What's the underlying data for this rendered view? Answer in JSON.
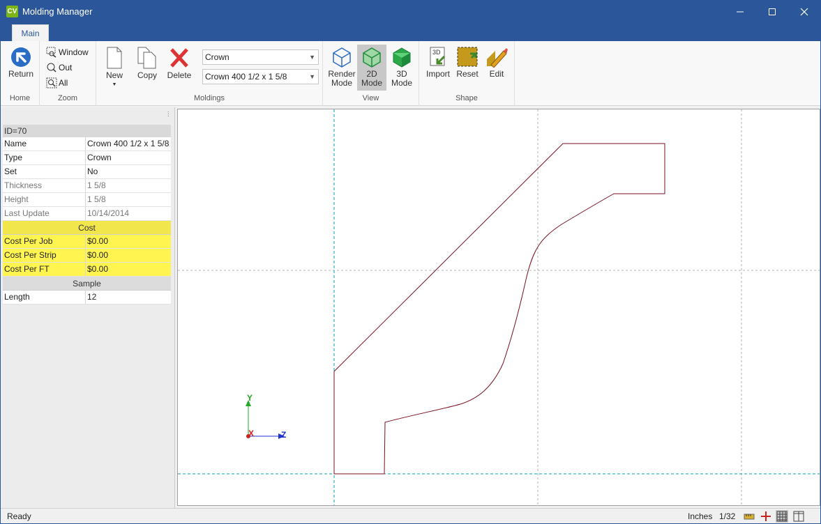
{
  "window": {
    "title": "Molding Manager",
    "icon_text": "CV"
  },
  "tabs": {
    "main": "Main"
  },
  "ribbon": {
    "home": {
      "return_label": "Return",
      "group": "Home"
    },
    "zoom": {
      "window": "Window",
      "out": "Out",
      "all": "All",
      "group": "Zoom"
    },
    "moldings": {
      "new": "New",
      "copy": "Copy",
      "delete": "Delete",
      "type_select": "Crown",
      "profile_select": "Crown 400 1/2 x 1 5/8",
      "group": "Moldings"
    },
    "view": {
      "render_line1": "Render",
      "render_line2": "Mode",
      "twod_line1": "2D",
      "twod_line2": "Mode",
      "threed_line1": "3D",
      "threed_line2": "Mode",
      "group": "View"
    },
    "shape": {
      "import": "Import",
      "reset": "Reset",
      "edit": "Edit",
      "group": "Shape",
      "import_badge": "3D"
    }
  },
  "properties": {
    "id": "ID=70",
    "rows": [
      {
        "name": "Name",
        "value": "Crown 400 1/2 x 1 5/8"
      },
      {
        "name": "Type",
        "value": "Crown"
      },
      {
        "name": "Set",
        "value": "No"
      },
      {
        "name": "Thickness",
        "value": "1 5/8"
      },
      {
        "name": "Height",
        "value": "1 5/8"
      },
      {
        "name": "Last Update",
        "value": "10/14/2014"
      }
    ],
    "cost_section": "Cost",
    "cost_rows": [
      {
        "name": "Cost Per Job",
        "value": "$0.00"
      },
      {
        "name": "Cost Per Strip",
        "value": "$0.00"
      },
      {
        "name": "Cost Per FT",
        "value": "$0.00"
      }
    ],
    "sample_section": "Sample",
    "sample_rows": [
      {
        "name": "Length",
        "value": "12"
      }
    ]
  },
  "axes": {
    "y": "Y",
    "x": "X",
    "z": "Z"
  },
  "status": {
    "ready": "Ready",
    "units": "Inches",
    "precision": "1/32"
  },
  "colors": {
    "accent": "#2b579a",
    "profile": "#7a1020",
    "highlight": "#fff450",
    "guide": "#00a0b0"
  }
}
